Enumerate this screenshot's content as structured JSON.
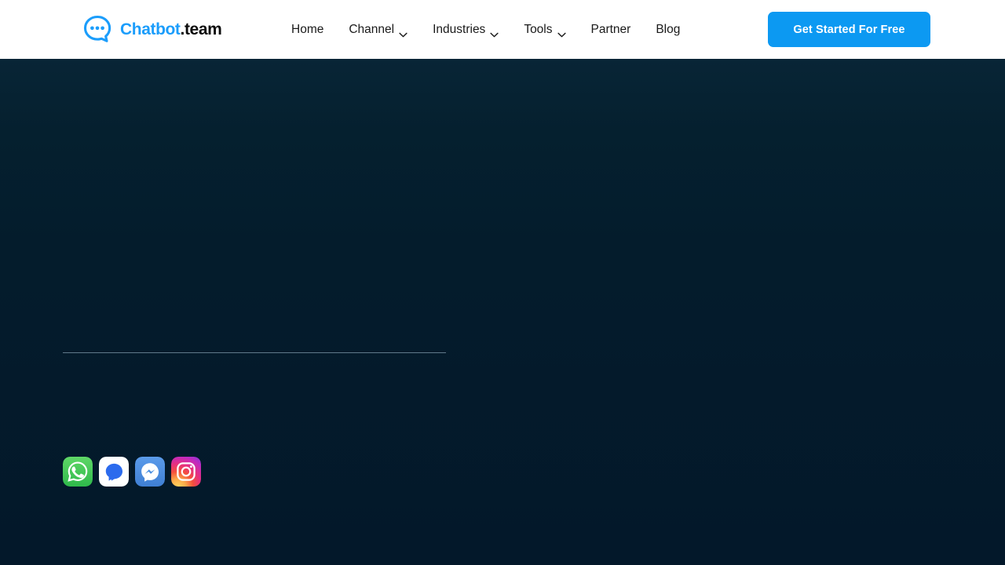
{
  "brand": {
    "name_primary": "Chatbot",
    "name_suffix": ".team",
    "mark_icon": "chat-bubble-dots-icon",
    "primary_color": "#1b9dfb",
    "suffix_color": "#0b0b0b"
  },
  "header": {
    "background_color": "#ffffff",
    "nav": [
      {
        "label": "Home",
        "has_dropdown": false,
        "icon": ""
      },
      {
        "label": "Channel",
        "has_dropdown": true,
        "icon": "chevron-down-icon"
      },
      {
        "label": "Industries",
        "has_dropdown": true,
        "icon": "chevron-down-icon"
      },
      {
        "label": "Tools",
        "has_dropdown": true,
        "icon": "chevron-down-icon"
      },
      {
        "label": "Partner",
        "has_dropdown": false,
        "icon": ""
      },
      {
        "label": "Blog",
        "has_dropdown": false,
        "icon": ""
      }
    ],
    "cta": {
      "label": "Get Started For Free",
      "background_color": "#0c99f2",
      "text_color": "#ffffff"
    }
  },
  "hero": {
    "background_color": "#041c2c",
    "headline": "",
    "subhead": "",
    "divider_color": "#60798a",
    "channels_label": "",
    "channels": [
      {
        "name": "WhatsApp",
        "icon": "whatsapp-icon",
        "color": "#4ac959"
      },
      {
        "name": "Google Messages",
        "icon": "messages-icon",
        "color": "#ffffff"
      },
      {
        "name": "Facebook Messenger",
        "icon": "messenger-icon",
        "color": "#4a8ee0"
      },
      {
        "name": "Instagram",
        "icon": "instagram-icon",
        "color": "#e1306c"
      }
    ]
  }
}
